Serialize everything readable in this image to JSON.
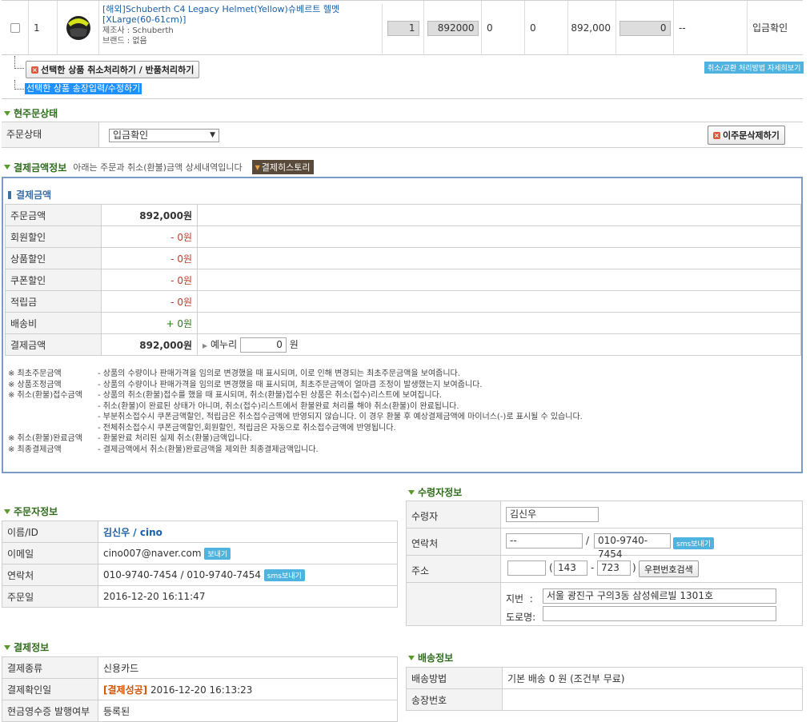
{
  "order_row": {
    "no": "1",
    "product_name": "[해외]Schuberth C4 Legacy Helmet(Yellow)슈베르트 헬멧[XLarge(60-61cm)]",
    "maker": "제조사 : Schuberth",
    "brand": "브랜드 : 없음",
    "qty": "1",
    "price": "892000",
    "col5": "0",
    "col6": "0",
    "amount": "892,000",
    "col8": "0",
    "col9": "--",
    "status": "입금확인"
  },
  "actions": {
    "cancel_return_label": "선택한 상품 취소처리하기 / 반품처리하기",
    "invoice_label": "선택한 상품 송장입력/수정하기",
    "guide_label": "취소/교환 처리방법 자세히보기"
  },
  "current_status": {
    "title": "현주문상태",
    "label": "주문상태",
    "selected": "입금확인",
    "delete_label": "이주문삭제하기"
  },
  "payment_info": {
    "title": "결제금액정보",
    "subtitle": "아래는 주문과 취소(환불)금액 상세내역입니다",
    "history_label": "결제히스토리",
    "box_title": "결제금액",
    "rows": [
      {
        "label": "주문금액",
        "value": "892,000원",
        "style": "bold"
      },
      {
        "label": "회원할인",
        "value": "- 0원",
        "style": "red"
      },
      {
        "label": "상품할인",
        "value": "- 0원",
        "style": "red"
      },
      {
        "label": "쿠폰할인",
        "value": "- 0원",
        "style": "red"
      },
      {
        "label": "적립금",
        "value": "- 0원",
        "style": "red"
      },
      {
        "label": "배송비",
        "value": "+ 0원",
        "style": "green"
      },
      {
        "label": "결제금액",
        "value": "892,000원",
        "style": "bold"
      }
    ],
    "deposit_label": "예누리",
    "deposit_value": "0",
    "deposit_unit": "원",
    "notes": [
      {
        "key": "※ 최초주문금액",
        "text": "- 상품의 수량이나 판매가격을 임의로 변경했을 때 표시되며, 이로 인해 변경되는 최초주문금액을 보여줍니다."
      },
      {
        "key": "※ 상품조정금액",
        "text": "- 상품의 수량이나 판매가격을 임의로 변경했을 때 표시되며, 최초주문금액이 얼마큼 조정이 발생했는지 보여줍니다."
      },
      {
        "key": "※ 취소(환불)접수금액",
        "text": "- 상품의 취소(환불)접수를 했을 때 표시되며, 취소(환불)접수된 상품은 취소(접수)리스트에 보여집니다."
      },
      {
        "key": "",
        "text": "- 취소(환불)이 완료된 상태가 아니며, 취소(접수)리스트에서 환불완료 처리를 해야 취소(환불)이 완료됩니다."
      },
      {
        "key": "",
        "text": "- 부분취소접수시 쿠폰금액할인, 적립금은 취소접수금액에 반영되지 않습니다. 이 경우 환불 후 예상결제금액에 마이너스(-)로 표시될 수 있습니다."
      },
      {
        "key": "",
        "text": "- 전체취소접수시 쿠폰금액할인,회원할인, 적립금은 자동으로 취소접수금액에 반영됩니다."
      },
      {
        "key": "※ 취소(환불)완료금액",
        "text": "- 환불완료 처리된 실제 취소(환불)금액입니다."
      },
      {
        "key": "※ 최종결제금액",
        "text": "- 결제금액에서 취소(환불)완료금액을 제외한 최종결제금액입니다."
      }
    ]
  },
  "orderer": {
    "title": "주문자정보",
    "name_label": "이름/ID",
    "name_value": "김신우 / cino",
    "email_label": "이메일",
    "email_value": "cino007@naver.com",
    "email_btn": "보내기",
    "phone_label": "연락처",
    "phone_value": "010-9740-7454 / 010-9740-7454",
    "sms_btn": "sms보내기",
    "date_label": "주문일",
    "date_value": "2016-12-20 16:11:47"
  },
  "receiver": {
    "title": "수령자정보",
    "name_label": "수령자",
    "name_value": "김신우",
    "phone_label": "연락처",
    "phone1": "--",
    "phone2": "010-9740-7454",
    "sms_btn": "sms보내기",
    "addr_label": "주소",
    "zip1": "143",
    "zip2": "723",
    "zip_btn": "우편번호검색",
    "jibun_label": "지번",
    "jibun_value": "서울 광진구 구의3동 삼성쉐르빌 1301호",
    "road_label": "도로명:"
  },
  "payment": {
    "title": "결제정보",
    "type_label": "결제종류",
    "type_value": "신용카드",
    "date_label": "결제확인일",
    "date_tag": "[결제성공]",
    "date_value": "2016-12-20 16:13:23",
    "row3_label": "현금영수증 발행여부",
    "row3_value": "등록된"
  },
  "shipping": {
    "title": "배송정보",
    "method_label": "배송방법",
    "method_value": "기본 배송 0 원 (조건부 무료)",
    "invoice_label": "송장번호"
  }
}
